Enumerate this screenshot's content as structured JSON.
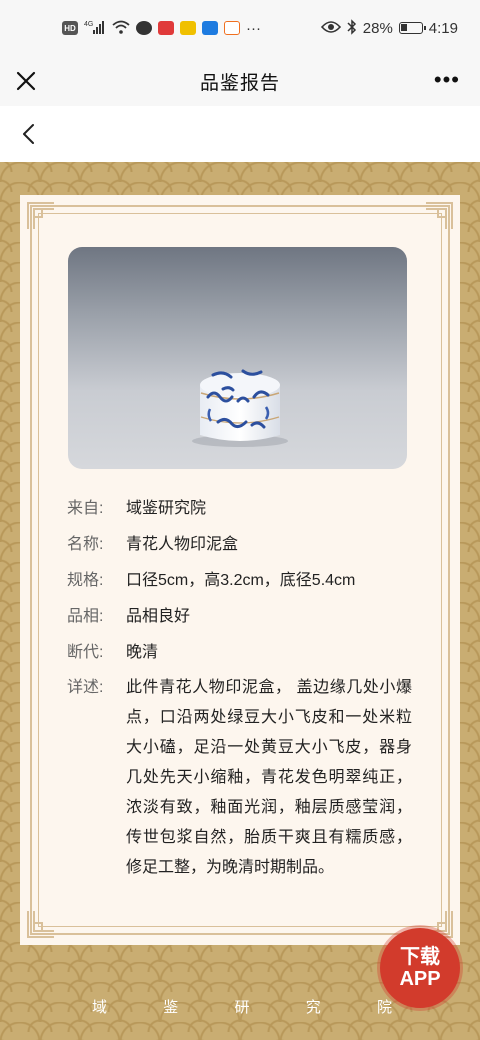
{
  "status_bar": {
    "left_icons": [
      "hd-icon",
      "signal-4g-icon",
      "wifi-icon",
      "app-icon-1",
      "app-icon-2",
      "app-icon-3",
      "app-icon-4",
      "app-icon-5"
    ],
    "hd_label": "HD",
    "net_label": "4G",
    "more": "···",
    "battery": "28%",
    "time": "4:19"
  },
  "nav": {
    "title": "品鉴报告",
    "more": "•••"
  },
  "report": {
    "fields": [
      {
        "key": "来自:",
        "value": "域鉴研究院"
      },
      {
        "key": "名称:",
        "value": "青花人物印泥盒"
      },
      {
        "key": "规格:",
        "value": "口径5cm，高3.2cm，底径5.4cm"
      },
      {
        "key": "品相:",
        "value": "品相良好"
      },
      {
        "key": "断代:",
        "value": "晚清"
      }
    ],
    "desc_key": "详述:",
    "desc_value": "此件青花人物印泥盒， 盖边缘几处小爆点，口沿两处绿豆大小飞皮和一处米粒大小磕，足沿一处黄豆大小飞皮，器身几处先天小缩釉，青花发色明翠纯正，浓淡有致，釉面光润，釉层质感莹润，传世包浆自然，胎质干爽且有糯质感，修足工整，为晚清时期制品。"
  },
  "download": {
    "line1": "下载",
    "line2": "APP"
  },
  "footer": [
    "域",
    "鉴",
    "研",
    "究",
    "院"
  ],
  "colors": {
    "gold": "#c9ad72",
    "card": "#fdf6ee",
    "frame": "#d9c09a",
    "badge": "#d23b2c"
  }
}
